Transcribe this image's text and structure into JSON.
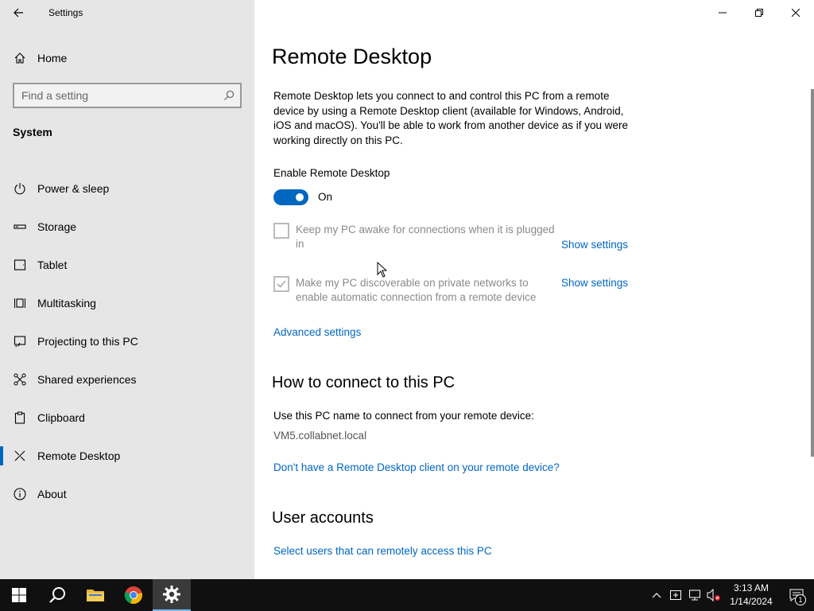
{
  "window": {
    "title": "Settings"
  },
  "sidebar": {
    "home_label": "Home",
    "search_placeholder": "Find a setting",
    "section": "System",
    "items": [
      {
        "label": "Power & sleep",
        "icon": "power-icon"
      },
      {
        "label": "Storage",
        "icon": "storage-icon"
      },
      {
        "label": "Tablet",
        "icon": "tablet-icon"
      },
      {
        "label": "Multitasking",
        "icon": "multitasking-icon"
      },
      {
        "label": "Projecting to this PC",
        "icon": "projecting-icon"
      },
      {
        "label": "Shared experiences",
        "icon": "shared-experiences-icon"
      },
      {
        "label": "Clipboard",
        "icon": "clipboard-icon"
      },
      {
        "label": "Remote Desktop",
        "icon": "remote-desktop-icon",
        "active": true
      },
      {
        "label": "About",
        "icon": "info-icon"
      }
    ]
  },
  "main": {
    "title": "Remote Desktop",
    "description": "Remote Desktop lets you connect to and control this PC from a remote device by using a Remote Desktop client (available for Windows, Android, iOS and macOS). You'll be able to work from another device as if you were working directly on this PC.",
    "enable_label": "Enable Remote Desktop",
    "toggle_state": "On",
    "keep_awake": {
      "text": "Keep my PC awake for connections when it is plugged in",
      "checked": false,
      "link": "Show settings"
    },
    "discoverable": {
      "text": "Make my PC discoverable on private networks to enable automatic connection from a remote device",
      "checked": true,
      "link": "Show settings"
    },
    "advanced_link": "Advanced settings",
    "connect_heading": "How to connect to this PC",
    "connect_instruction": "Use this PC name to connect from your remote device:",
    "pc_name": "VM5.collabnet.local",
    "client_link": "Don't have a Remote Desktop client on your remote device?",
    "accounts_heading": "User accounts",
    "accounts_link": "Select users that can remotely access this PC"
  },
  "taskbar": {
    "time": "3:13 AM",
    "date": "1/14/2024",
    "notification_count": "1",
    "accent": "#76b9ed"
  },
  "colors": {
    "accent": "#0067c0",
    "sidebar_bg": "#e6e6e6",
    "taskbar_bg": "#101010"
  }
}
